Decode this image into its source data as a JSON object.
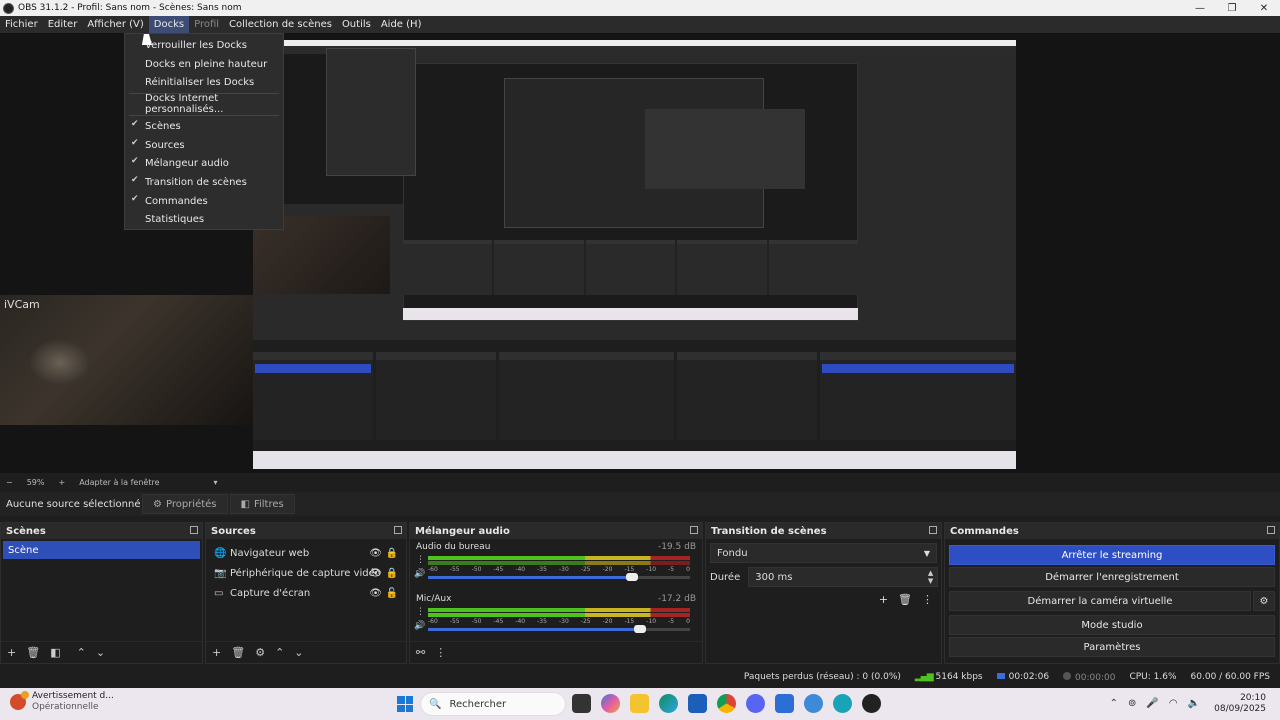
{
  "window": {
    "title": "OBS 31.1.2 - Profil: Sans nom - Scènes: Sans nom"
  },
  "menubar": {
    "items": [
      "Fichier",
      "Editer",
      "Afficher (V)",
      "Docks",
      "Profil",
      "Collection de scènes",
      "Outils",
      "Aide (H)"
    ]
  },
  "docks_menu": {
    "items": [
      {
        "label": "Verrouiller les Docks",
        "checked": false
      },
      {
        "label": "Docks en pleine hauteur",
        "checked": false
      },
      {
        "label": "Réinitialiser les Docks",
        "checked": false
      },
      {
        "label": "Docks Internet personnalisés...",
        "checked": false
      },
      {
        "label": "Scènes",
        "checked": true
      },
      {
        "label": "Sources",
        "checked": true
      },
      {
        "label": "Mélangeur audio",
        "checked": true
      },
      {
        "label": "Transition de scènes",
        "checked": true
      },
      {
        "label": "Commandes",
        "checked": true
      },
      {
        "label": "Statistiques",
        "checked": false
      }
    ]
  },
  "preview": {
    "camera_label": "iVCam"
  },
  "zoom": {
    "value": "59%",
    "fit": "Adapter à la fenêtre"
  },
  "source_toolbar": {
    "no_selection": "Aucune source sélectionné",
    "properties": "Propriétés",
    "filters": "Filtres"
  },
  "scenes_dock": {
    "title": "Scènes",
    "items": [
      "Scène"
    ]
  },
  "sources_dock": {
    "title": "Sources",
    "items": [
      {
        "label": "Navigateur web",
        "icon": "globe-icon"
      },
      {
        "label": "Périphérique de capture vidéo",
        "icon": "camera-icon"
      },
      {
        "label": "Capture d'écran",
        "icon": "monitor-icon"
      }
    ]
  },
  "mixer_dock": {
    "title": "Mélangeur audio",
    "scale": [
      "-60",
      "-55",
      "-50",
      "-45",
      "-40",
      "-35",
      "-30",
      "-25",
      "-20",
      "-15",
      "-10",
      "-5",
      "0"
    ],
    "channels": [
      {
        "name": "Audio du bureau",
        "db": "-19.5 dB",
        "volume": 0.78
      },
      {
        "name": "Mic/Aux",
        "db": "-17.2 dB",
        "volume": 0.81
      }
    ]
  },
  "transition_dock": {
    "title": "Transition de scènes",
    "type": "Fondu",
    "duration_label": "Durée",
    "duration": "300 ms"
  },
  "controls_dock": {
    "title": "Commandes",
    "stop_streaming": "Arrêter le streaming",
    "start_recording": "Démarrer l'enregistrement",
    "start_virtualcam": "Démarrer la caméra virtuelle",
    "studio_mode": "Mode studio",
    "settings": "Paramètres"
  },
  "status": {
    "dropped": "Paquets perdus (réseau) : 0 (0.0%)",
    "bitrate": "5164 kbps",
    "stream_time": "00:02:06",
    "rec_time": "00:00:00",
    "cpu": "CPU: 1.6%",
    "fps": "60.00 / 60.00 FPS"
  },
  "taskbar": {
    "notif_title": "Avertissement d...",
    "notif_sub": "Opérationnelle",
    "search": "Rechercher",
    "time": "20:10",
    "date": "08/09/2025"
  },
  "colors": {
    "accent": "#2e4fc4",
    "menu_active": "#3c4c75"
  }
}
